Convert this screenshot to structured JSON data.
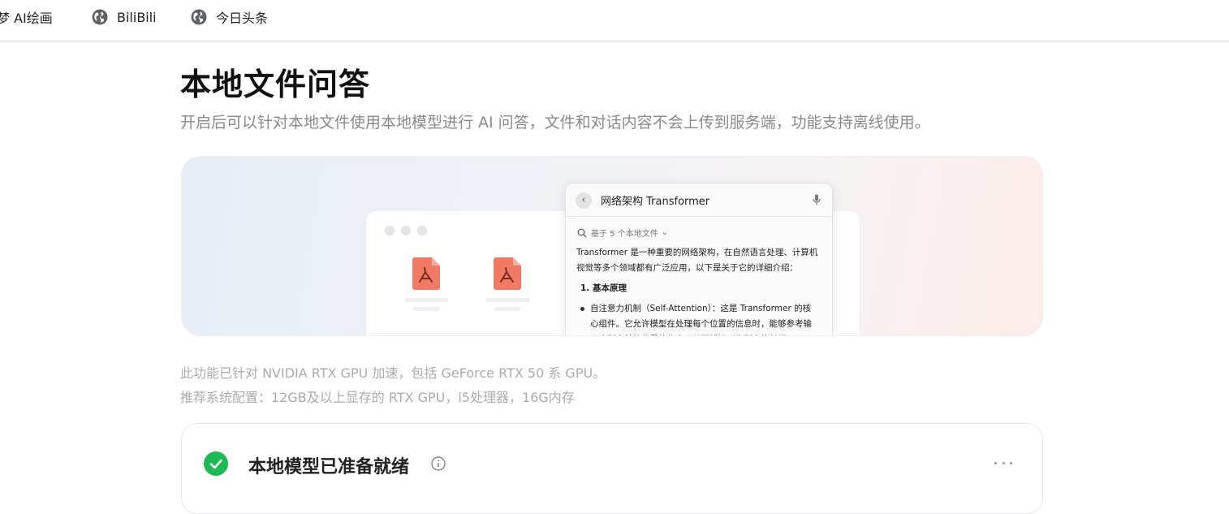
{
  "bookmarks": [
    {
      "label": "梦 AI绘画",
      "icon": "none"
    },
    {
      "label": "BiliBili",
      "icon": "globe-icon"
    },
    {
      "label": "今日头条",
      "icon": "globe-icon"
    }
  ],
  "page": {
    "title": "本地文件问答",
    "subtitle": "开启后可以针对本地文件使用本地模型进行 AI 问答，文件和对话内容不会上传到服务端，功能支持离线使用。"
  },
  "illustration": {
    "chat_title": "网络架构 Transformer",
    "source_label": "基于 5 个本地文件",
    "answer_intro": "Transformer 是一种重要的网络架构，在自然语言处理、计算机视觉等多个领域都有广泛应用，以下是关于它的详细介绍：",
    "section_heading": "1. 基本原理",
    "bullet_text": "自注意力机制（Self-Attention）：这是 Transformer 的核心组件。它允许模型在处理每个位置的信息时，能够参考输入序列中其他位置的信息，从而捕捉到序列中的长距"
  },
  "notes": {
    "gpu_acceleration": "此功能已针对 NVIDIA RTX GPU 加速，包括 GeForce RTX 50 系 GPU。",
    "recommended_config": "推荐系统配置：12GB及以上显存的 RTX GPU，i5处理器，16G内存"
  },
  "status_card": {
    "title": "本地模型已准备就绪",
    "status_color": "#1db954"
  }
}
